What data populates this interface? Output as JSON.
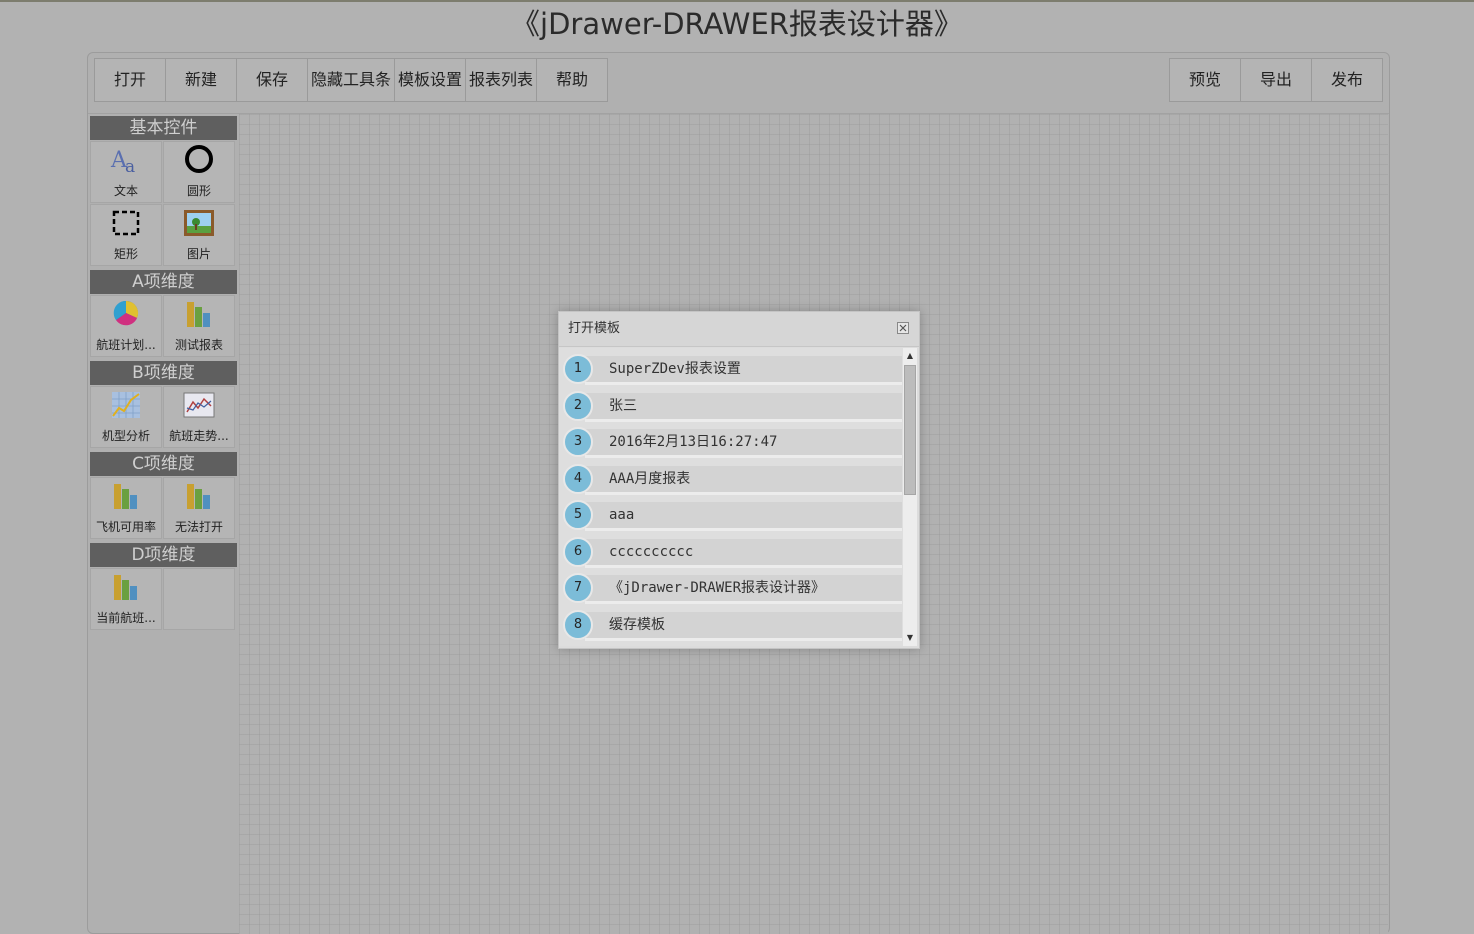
{
  "title": "《jDrawer-DRAWER报表设计器》",
  "toolbar": {
    "left": [
      {
        "label": "打开",
        "name": "open-button"
      },
      {
        "label": "新建",
        "name": "new-button"
      },
      {
        "label": "保存",
        "name": "save-button"
      },
      {
        "label": "隐藏工具条",
        "name": "hide-toolbar-button"
      },
      {
        "label": "模板设置",
        "name": "template-settings-button"
      },
      {
        "label": "报表列表",
        "name": "report-list-button"
      },
      {
        "label": "帮助",
        "name": "help-button"
      }
    ],
    "right": [
      {
        "label": "预览",
        "name": "preview-button"
      },
      {
        "label": "导出",
        "name": "export-button"
      },
      {
        "label": "发布",
        "name": "publish-button"
      }
    ]
  },
  "palette": {
    "groups": [
      {
        "title": "基本控件",
        "items": [
          {
            "label": "文本",
            "icon": "text-icon"
          },
          {
            "label": "圆形",
            "icon": "circle-icon"
          },
          {
            "label": "矩形",
            "icon": "rectangle-icon"
          },
          {
            "label": "图片",
            "icon": "image-icon"
          }
        ]
      },
      {
        "title": "A项维度",
        "items": [
          {
            "label": "航班计划...",
            "icon": "pie-chart-icon"
          },
          {
            "label": "测试报表",
            "icon": "bar-chart-icon"
          }
        ]
      },
      {
        "title": "B项维度",
        "items": [
          {
            "label": "机型分析",
            "icon": "line-chart-icon"
          },
          {
            "label": "航班走势...",
            "icon": "trend-chart-icon"
          }
        ]
      },
      {
        "title": "C项维度",
        "items": [
          {
            "label": "飞机可用率",
            "icon": "bar-chart-icon"
          },
          {
            "label": "无法打开",
            "icon": "bar-chart-icon"
          }
        ]
      },
      {
        "title": "D项维度",
        "items": [
          {
            "label": "当前航班...",
            "icon": "bar-chart-icon"
          }
        ]
      }
    ]
  },
  "dialog": {
    "title": "打开模板",
    "items": [
      {
        "num": "1",
        "label": "SuperZDev报表设置"
      },
      {
        "num": "2",
        "label": "张三"
      },
      {
        "num": "3",
        "label": "2016年2月13日16:27:47"
      },
      {
        "num": "4",
        "label": "AAA月度报表"
      },
      {
        "num": "5",
        "label": "aaa"
      },
      {
        "num": "6",
        "label": "cccccccccc"
      },
      {
        "num": "7",
        "label": "《jDrawer-DRAWER报表设计器》"
      },
      {
        "num": "8",
        "label": "缓存模板"
      }
    ]
  },
  "colors": {
    "background": "#b2b2b2",
    "palette_header": "#5f5f5f",
    "list_number": "#7cbcd8"
  }
}
